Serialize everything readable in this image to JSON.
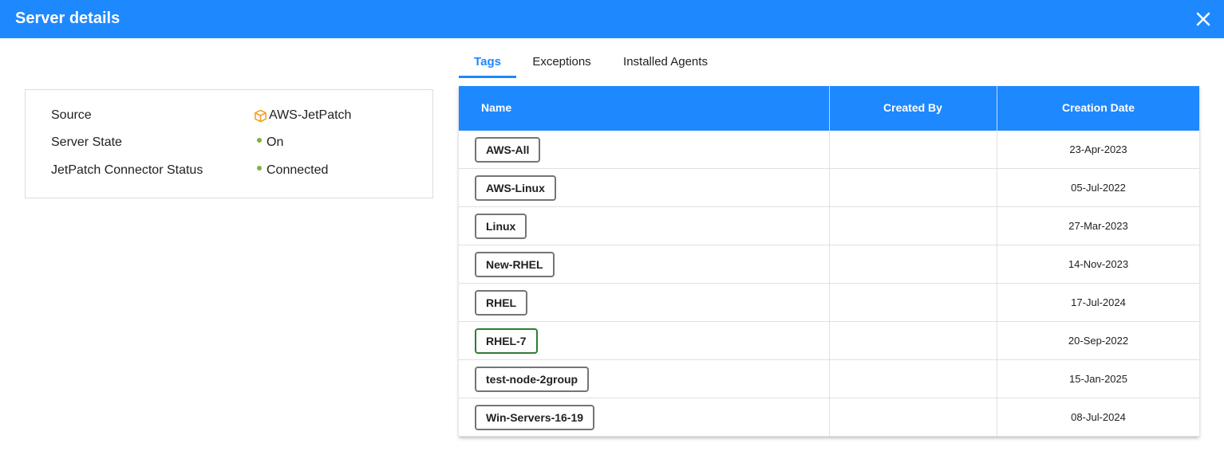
{
  "dialog": {
    "title": "Server details"
  },
  "details": [
    {
      "label": "Source",
      "value": "AWS-JetPatch",
      "icon": "box-icon"
    },
    {
      "label": "Server State",
      "value": "On",
      "icon": "status-dot"
    },
    {
      "label": "JetPatch Connector Status",
      "value": "Connected",
      "icon": "status-dot"
    }
  ],
  "colors": {
    "accent": "#1e88ff",
    "status_green": "#7cb342",
    "source_icon": "#f59c1a",
    "selected_tag_border": "#2e7d32"
  },
  "tabs": [
    {
      "label": "Tags",
      "active": true
    },
    {
      "label": "Exceptions",
      "active": false
    },
    {
      "label": "Installed Agents",
      "active": false
    }
  ],
  "table": {
    "columns": [
      "Name",
      "Created By",
      "Creation Date"
    ],
    "rows": [
      {
        "name": "AWS-All",
        "created_by": "",
        "date": "23-Apr-2023",
        "selected": false
      },
      {
        "name": "AWS-Linux",
        "created_by": "",
        "date": "05-Jul-2022",
        "selected": false
      },
      {
        "name": "Linux",
        "created_by": "",
        "date": "27-Mar-2023",
        "selected": false
      },
      {
        "name": "New-RHEL",
        "created_by": "",
        "date": "14-Nov-2023",
        "selected": false
      },
      {
        "name": "RHEL",
        "created_by": "",
        "date": "17-Jul-2024",
        "selected": false
      },
      {
        "name": "RHEL-7",
        "created_by": "",
        "date": "20-Sep-2022",
        "selected": true
      },
      {
        "name": "test-node-2group",
        "created_by": "",
        "date": "15-Jan-2025",
        "selected": false
      },
      {
        "name": "Win-Servers-16-19",
        "created_by": "",
        "date": "08-Jul-2024",
        "selected": false
      }
    ]
  }
}
